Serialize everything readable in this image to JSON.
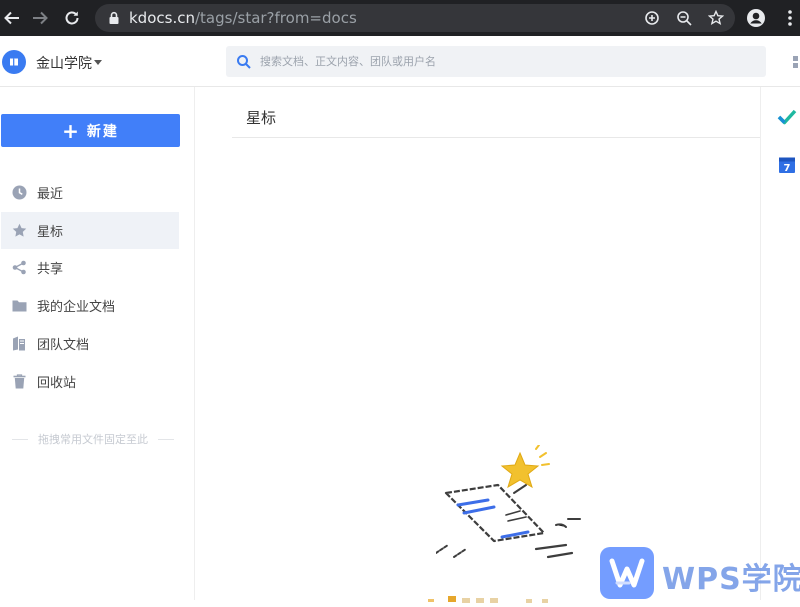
{
  "browser": {
    "url_host": "kdocs.cn",
    "url_path": "/tags/star?from=docs"
  },
  "header": {
    "org_name": "金山学院",
    "search_placeholder": "搜索文档、正文内容、团队或用户名"
  },
  "sidebar": {
    "new_button_label": "新建",
    "items": [
      {
        "label": "最近",
        "icon": "clock-icon"
      },
      {
        "label": "星标",
        "icon": "star-icon",
        "active": true
      },
      {
        "label": "共享",
        "icon": "share-icon"
      },
      {
        "label": "我的企业文档",
        "icon": "folder-icon"
      },
      {
        "label": "团队文档",
        "icon": "team-docs-icon"
      },
      {
        "label": "回收站",
        "icon": "trash-icon"
      }
    ],
    "drag_hint": "拖拽常用文件固定至此"
  },
  "main": {
    "title": "星标"
  },
  "watermark": {
    "text": "WPS学院"
  },
  "colors": {
    "accent": "#417ff9",
    "active_bg": "#eff2f7",
    "chrome_bg": "#202124",
    "star": "#f2c12e"
  }
}
